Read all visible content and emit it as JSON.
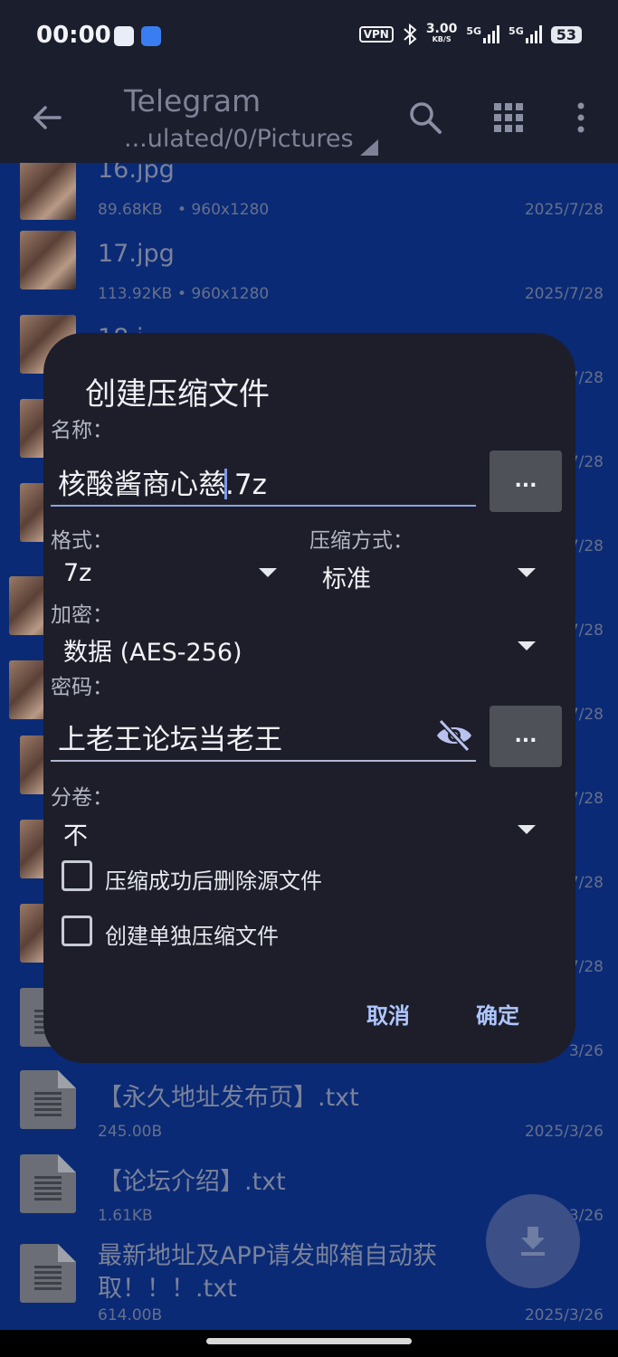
{
  "status_bar": {
    "time": "00:00",
    "vpn": "VPN",
    "speed": "3.00",
    "speed_unit": "KB/S",
    "net1": "5G",
    "net2": "5G",
    "battery": "53"
  },
  "toolbar": {
    "title": "Telegram",
    "path": "...ulated/0/Pictures",
    "icons": [
      "back-arrow-icon",
      "search-icon",
      "grid-view-icon",
      "more-vert-icon"
    ]
  },
  "files": [
    {
      "name": "16.jpg",
      "size": "89.68KB",
      "res": "• 960x1280",
      "date": "2025/7/28",
      "type": "photo"
    },
    {
      "name": "17.jpg",
      "size": "113.92KB",
      "res": "• 960x1280",
      "date": "2025/7/28",
      "type": "photo"
    },
    {
      "name": "18.j",
      "size": "",
      "res": "",
      "date": "7/28",
      "type": "photo"
    },
    {
      "name": "",
      "size": "",
      "res": "",
      "date": "7/28",
      "type": "photo"
    },
    {
      "name": "",
      "size": "",
      "res": "",
      "date": "7/28",
      "type": "photo"
    },
    {
      "name": "",
      "size": "",
      "res": "",
      "date": "7/28",
      "type": "photo"
    },
    {
      "name": "",
      "size": "",
      "res": "",
      "date": "7/28",
      "type": "photo"
    },
    {
      "name": "",
      "size": "",
      "res": "",
      "date": "7/28",
      "type": "photo"
    },
    {
      "name": "",
      "size": "",
      "res": "",
      "date": "7/28",
      "type": "photo"
    },
    {
      "name": "",
      "size": "",
      "res": "",
      "date": "7/28",
      "type": "photo"
    },
    {
      "name": "",
      "size": "",
      "res": "",
      "date": "7/28",
      "type": "photo"
    },
    {
      "name": "",
      "size": "",
      "res": "",
      "date": "3/26",
      "type": "doc"
    },
    {
      "name": "【永久地址发布页】.txt",
      "size": "245.00B",
      "res": "",
      "date": "2025/3/26",
      "type": "doc"
    },
    {
      "name": "【论坛介绍】.txt",
      "size": "1.61KB",
      "res": "",
      "date": "3/26",
      "type": "doc"
    },
    {
      "name": "最新地址及APP请发邮箱自动获取！！！.txt",
      "size": "614.00B",
      "res": "",
      "date": "2025/3/26",
      "type": "doc"
    }
  ],
  "dialog": {
    "title": "创建压缩文件",
    "name_label": "名称：",
    "name_value_before": "核酸酱商心慈",
    "name_value_after": ".7z",
    "browse_label": "...",
    "format_label": "格式：",
    "format_value": "7z",
    "method_label": "压缩方式：",
    "method_value": "标准",
    "encrypt_label": "加密：",
    "encrypt_value": "数据 (AES-256)",
    "password_label": "密码：",
    "password_value": "上老王论坛当老王",
    "password_more": "...",
    "split_label": "分卷：",
    "split_value": "不",
    "delete_source_label": "压缩成功后删除源文件",
    "delete_source_checked": false,
    "separate_archive_label": "创建单独压缩文件",
    "separate_archive_checked": false,
    "cancel_label": "取消",
    "ok_label": "确定"
  },
  "fab": {
    "icon": "download-icon"
  },
  "colors": {
    "list_bg": "#0a2a76",
    "dialog_bg": "#1d1e29",
    "accent": "#aec6ff"
  }
}
